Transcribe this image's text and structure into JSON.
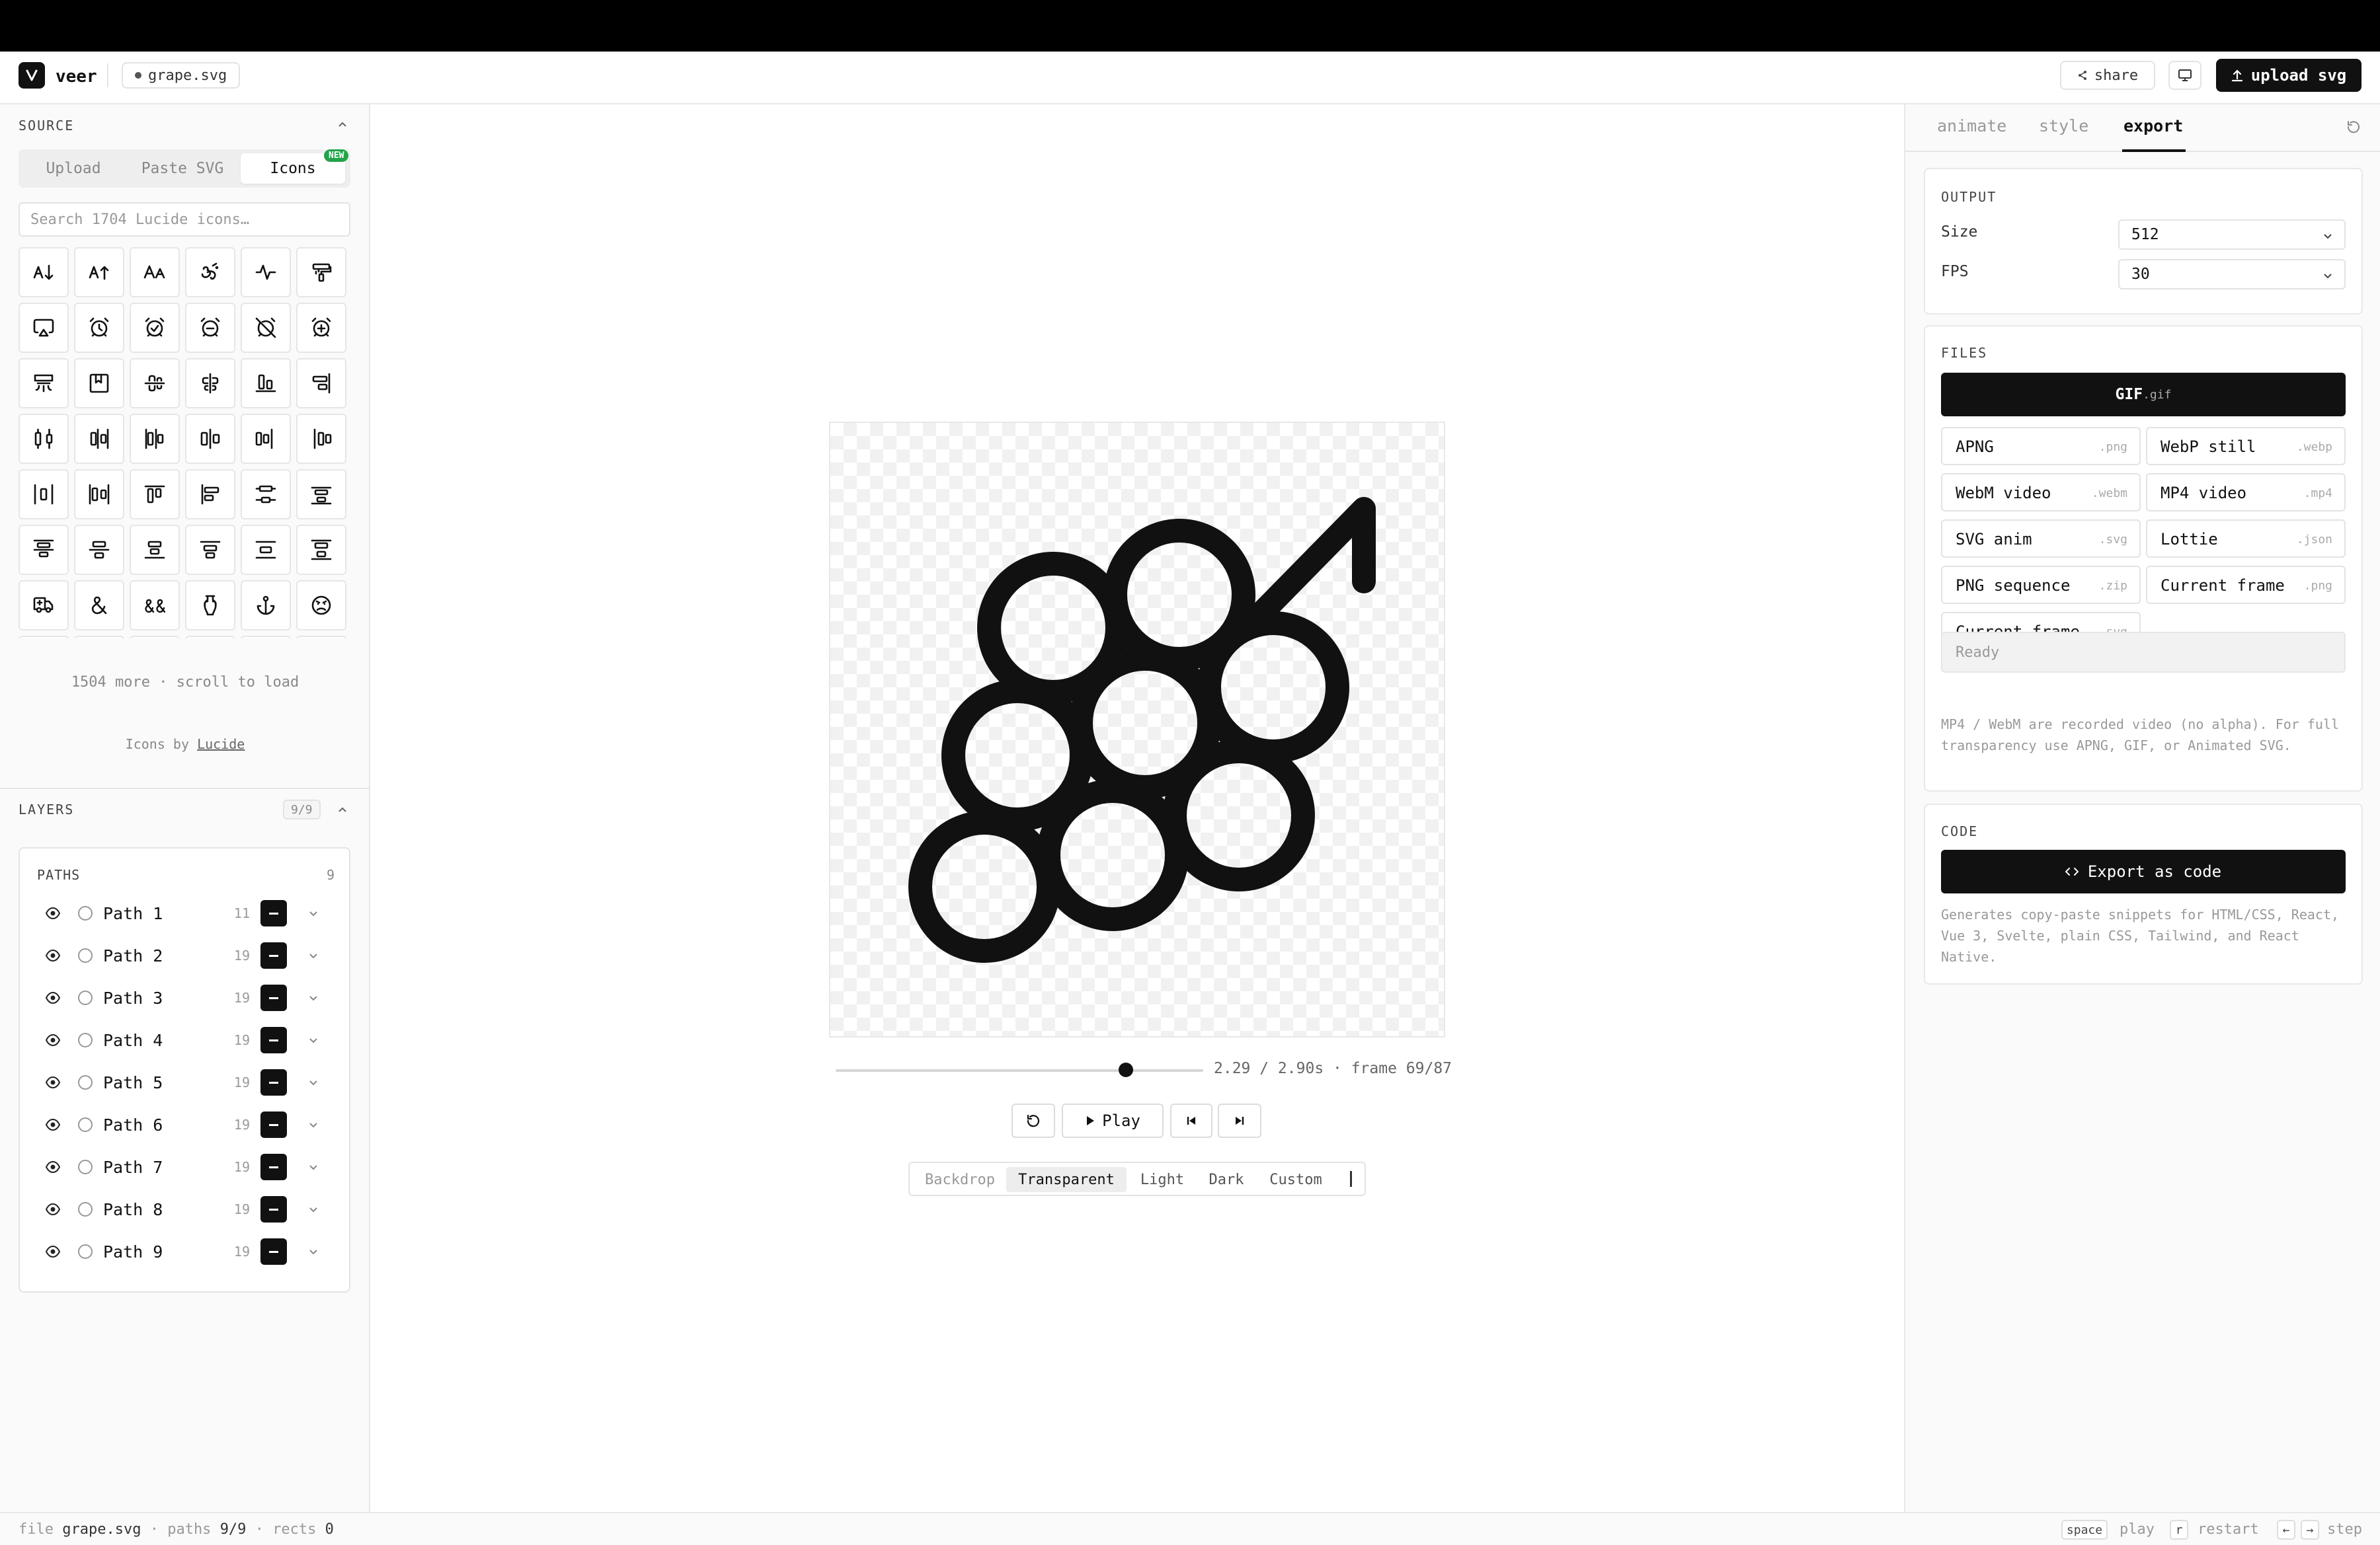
{
  "header": {
    "app_name": "veer",
    "file_name": "grape.svg",
    "share_label": "share",
    "upload_label": "upload svg"
  },
  "source": {
    "title": "SOURCE",
    "tabs": [
      "Upload",
      "Paste SVG",
      "Icons"
    ],
    "active_tab": "Icons",
    "new_badge": "NEW",
    "search_placeholder": "Search 1704 Lucide icons…",
    "more_text": "1504 more · scroll to load",
    "credit_prefix": "Icons by",
    "credit_link": "Lucide"
  },
  "layers": {
    "title": "LAYERS",
    "count": "9/9",
    "paths_title": "PATHS",
    "paths_total": "9",
    "items": [
      {
        "name": "Path 1",
        "count": "11",
        "color": "#111111"
      },
      {
        "name": "Path 2",
        "count": "19",
        "color": "#111111"
      },
      {
        "name": "Path 3",
        "count": "19",
        "color": "#111111"
      },
      {
        "name": "Path 4",
        "count": "19",
        "color": "#111111"
      },
      {
        "name": "Path 5",
        "count": "19",
        "color": "#111111"
      },
      {
        "name": "Path 6",
        "count": "19",
        "color": "#111111"
      },
      {
        "name": "Path 7",
        "count": "19",
        "color": "#111111"
      },
      {
        "name": "Path 8",
        "count": "19",
        "color": "#111111"
      },
      {
        "name": "Path 9",
        "count": "19",
        "color": "#111111"
      }
    ]
  },
  "player": {
    "time": "2.29 / 2.90s · frame 69/87",
    "progress": 0.79,
    "play_label": "Play",
    "backdrop_label": "Backdrop",
    "backdrop_options": [
      "Transparent",
      "Light",
      "Dark",
      "Custom"
    ],
    "backdrop_active": "Transparent"
  },
  "right": {
    "tabs": [
      "animate",
      "style",
      "export"
    ],
    "active_tab": "export",
    "output": {
      "title": "OUTPUT",
      "size_label": "Size",
      "size_value": "512",
      "fps_label": "FPS",
      "fps_value": "30"
    },
    "files": {
      "title": "FILES",
      "primary_name": "GIF",
      "primary_ext": ".gif",
      "formats": [
        {
          "name": "APNG",
          "ext": ".png"
        },
        {
          "name": "WebP still",
          "ext": ".webp"
        },
        {
          "name": "WebM video",
          "ext": ".webm"
        },
        {
          "name": "MP4 video",
          "ext": ".mp4"
        },
        {
          "name": "SVG anim",
          "ext": ".svg"
        },
        {
          "name": "Lottie",
          "ext": ".json"
        },
        {
          "name": "PNG sequence",
          "ext": ".zip"
        },
        {
          "name": "Current frame",
          "ext": ".png"
        },
        {
          "name": "Current frame",
          "ext": ".svg"
        }
      ],
      "status": "Ready",
      "note": "MP4 / WebM are recorded video (no alpha). For full transparency use APNG, GIF, or Animated SVG."
    },
    "code": {
      "title": "CODE",
      "button_label": "Export as code",
      "note": "Generates copy-paste snippets for HTML/CSS, React, Vue 3, Svelte, plain CSS, Tailwind, and React Native."
    }
  },
  "statusbar": {
    "file_label": "file",
    "file_value": "grape.svg",
    "paths_label": "paths",
    "paths_value": "9/9",
    "rects_label": "rects",
    "rects_value": "0",
    "key_space": "space",
    "space_action": "play",
    "key_r": "r",
    "r_action": "restart",
    "key_prev": "←",
    "key_next": "→",
    "step_action": "step"
  },
  "icons": [
    "arrow-down-a-z-icon",
    "arrow-up-a-z-icon",
    "case-sensitive-icon",
    "om-icon",
    "activity-icon",
    "paint-roller-icon",
    "airplay-icon",
    "alarm-clock-icon",
    "alarm-clock-check-icon",
    "alarm-clock-minus-icon",
    "alarm-clock-off-icon",
    "alarm-clock-plus-icon",
    "air-vent-icon",
    "album-icon",
    "align-center-horizontal-icon",
    "align-center-vertical-icon",
    "align-end-horizontal-icon",
    "align-end-vertical-icon",
    "align-horizontal-distribute-center-icon",
    "align-horizontal-distribute-end-icon",
    "align-horizontal-distribute-start-icon",
    "align-horizontal-justify-center-icon",
    "align-horizontal-justify-end-icon",
    "align-horizontal-justify-start-icon",
    "align-horizontal-space-around-icon",
    "align-horizontal-space-between-icon",
    "align-start-horizontal-icon",
    "align-start-vertical-icon",
    "align-vertical-distribute-center-icon",
    "align-vertical-distribute-end-icon",
    "align-vertical-distribute-start-icon",
    "align-vertical-justify-center-icon",
    "align-vertical-justify-end-icon",
    "align-vertical-justify-start-icon",
    "align-vertical-space-around-icon",
    "align-vertical-space-between-icon",
    "ambulance-icon",
    "ampersand-icon",
    "ampersands-icon",
    "amphora-icon",
    "anchor-icon",
    "angry-icon"
  ]
}
